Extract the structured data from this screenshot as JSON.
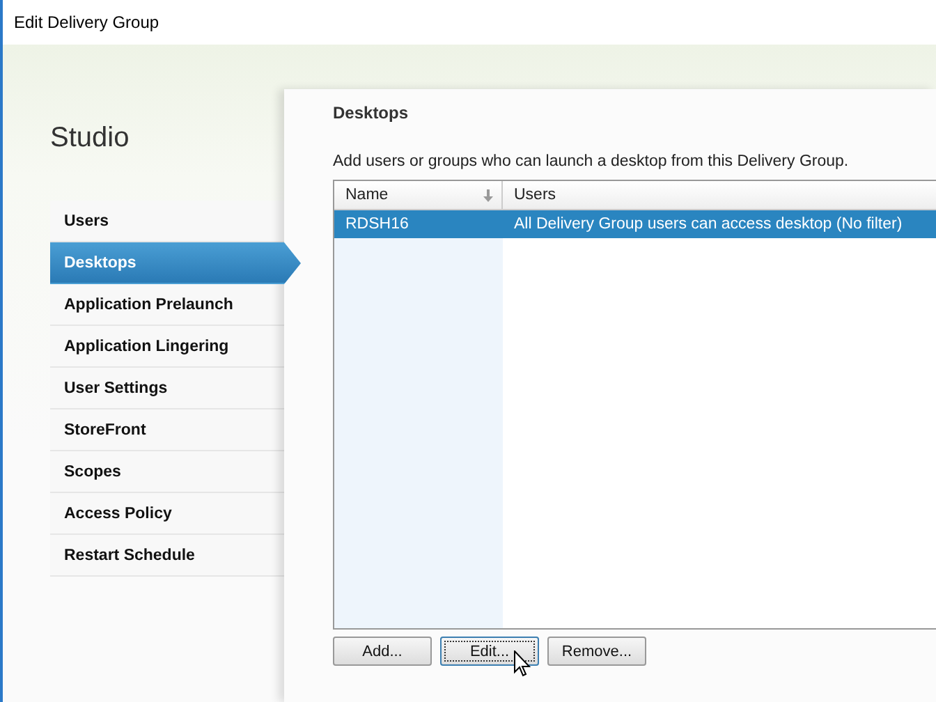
{
  "window": {
    "title": "Edit Delivery Group"
  },
  "sidebar": {
    "title": "Studio",
    "items": [
      {
        "label": "Users",
        "selected": false
      },
      {
        "label": "Desktops",
        "selected": true
      },
      {
        "label": "Application Prelaunch",
        "selected": false
      },
      {
        "label": "Application Lingering",
        "selected": false
      },
      {
        "label": "User Settings",
        "selected": false
      },
      {
        "label": "StoreFront",
        "selected": false
      },
      {
        "label": "Scopes",
        "selected": false
      },
      {
        "label": "Access Policy",
        "selected": false
      },
      {
        "label": "Restart Schedule",
        "selected": false
      }
    ]
  },
  "content": {
    "heading": "Desktops",
    "description": "Add users or groups who can launch a desktop from this Delivery Group.",
    "table": {
      "columns": [
        "Name",
        "Users"
      ],
      "rows": [
        {
          "cells": [
            "RDSH16",
            "All Delivery Group users can access desktop (No filter)"
          ],
          "selected": true
        }
      ]
    },
    "buttons": [
      {
        "label": "Add...",
        "focused": false
      },
      {
        "label": "Edit...",
        "focused": true
      },
      {
        "label": "Remove...",
        "focused": false
      }
    ]
  }
}
